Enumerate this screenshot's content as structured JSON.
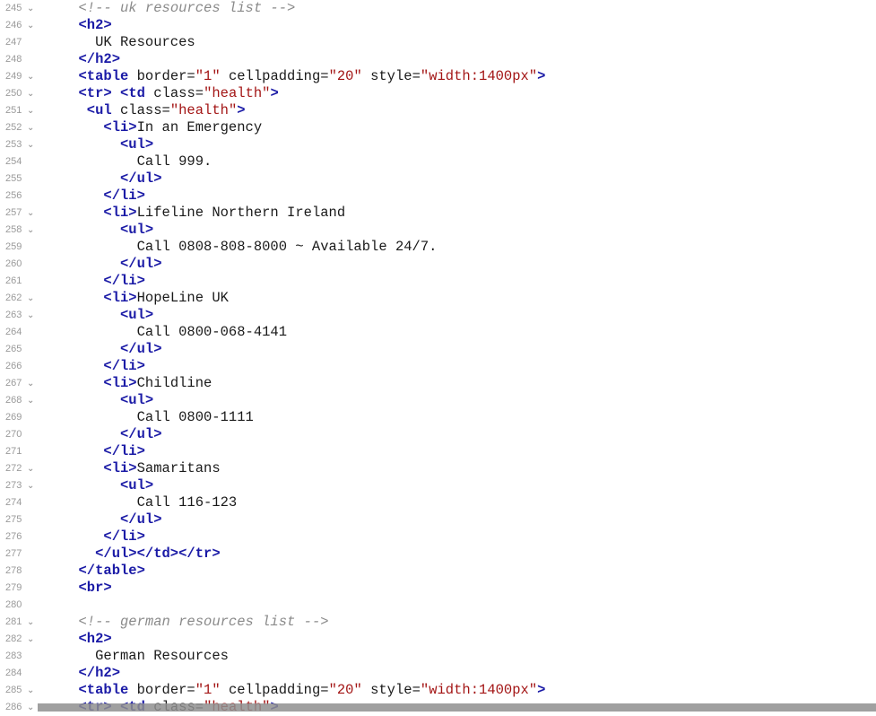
{
  "lines": [
    {
      "n": "245",
      "fold": true,
      "indent": 0,
      "tokens": [
        {
          "t": "cmt",
          "v": "<!-- uk resources list -->"
        }
      ]
    },
    {
      "n": "246",
      "fold": true,
      "indent": 0,
      "tokens": [
        {
          "t": "tag",
          "v": "<h2>"
        }
      ]
    },
    {
      "n": "247",
      "fold": false,
      "indent": 2,
      "tokens": [
        {
          "t": "txt",
          "v": "UK Resources"
        }
      ]
    },
    {
      "n": "248",
      "fold": false,
      "indent": 0,
      "tokens": [
        {
          "t": "tag",
          "v": "</h2>"
        }
      ]
    },
    {
      "n": "249",
      "fold": true,
      "indent": 0,
      "tokens": [
        {
          "t": "tag",
          "v": "<table"
        },
        {
          "t": "attr",
          "v": " border="
        },
        {
          "t": "str",
          "v": "\"1\""
        },
        {
          "t": "attr",
          "v": " cellpadding="
        },
        {
          "t": "str",
          "v": "\"20\""
        },
        {
          "t": "attr",
          "v": " style="
        },
        {
          "t": "str",
          "v": "\"width:1400px\""
        },
        {
          "t": "tag",
          "v": ">"
        }
      ]
    },
    {
      "n": "250",
      "fold": true,
      "indent": 0,
      "tokens": [
        {
          "t": "tag",
          "v": "<tr>"
        },
        {
          "t": "txt",
          "v": " "
        },
        {
          "t": "tag",
          "v": "<td"
        },
        {
          "t": "attr",
          "v": " class="
        },
        {
          "t": "str",
          "v": "\"health\""
        },
        {
          "t": "tag",
          "v": ">"
        }
      ]
    },
    {
      "n": "251",
      "fold": true,
      "indent": 1,
      "tokens": [
        {
          "t": "tag",
          "v": "<ul"
        },
        {
          "t": "attr",
          "v": " class="
        },
        {
          "t": "str",
          "v": "\"health\""
        },
        {
          "t": "tag",
          "v": ">"
        }
      ]
    },
    {
      "n": "252",
      "fold": true,
      "indent": 3,
      "tokens": [
        {
          "t": "tag",
          "v": "<li>"
        },
        {
          "t": "txt",
          "v": "In an Emergency"
        }
      ]
    },
    {
      "n": "253",
      "fold": true,
      "indent": 5,
      "tokens": [
        {
          "t": "tag",
          "v": "<ul>"
        }
      ]
    },
    {
      "n": "254",
      "fold": false,
      "indent": 7,
      "tokens": [
        {
          "t": "txt",
          "v": "Call 999."
        }
      ]
    },
    {
      "n": "255",
      "fold": false,
      "indent": 5,
      "tokens": [
        {
          "t": "tag",
          "v": "</ul>"
        }
      ]
    },
    {
      "n": "256",
      "fold": false,
      "indent": 3,
      "tokens": [
        {
          "t": "tag",
          "v": "</li>"
        }
      ]
    },
    {
      "n": "257",
      "fold": true,
      "indent": 3,
      "tokens": [
        {
          "t": "tag",
          "v": "<li>"
        },
        {
          "t": "txt",
          "v": "Lifeline Northern Ireland"
        }
      ]
    },
    {
      "n": "258",
      "fold": true,
      "indent": 5,
      "tokens": [
        {
          "t": "tag",
          "v": "<ul>"
        }
      ]
    },
    {
      "n": "259",
      "fold": false,
      "indent": 7,
      "tokens": [
        {
          "t": "txt",
          "v": "Call 0808-808-8000 ~ Available 24/7."
        }
      ]
    },
    {
      "n": "260",
      "fold": false,
      "indent": 5,
      "tokens": [
        {
          "t": "tag",
          "v": "</ul>"
        }
      ]
    },
    {
      "n": "261",
      "fold": false,
      "indent": 3,
      "tokens": [
        {
          "t": "tag",
          "v": "</li>"
        }
      ]
    },
    {
      "n": "262",
      "fold": true,
      "indent": 3,
      "tokens": [
        {
          "t": "tag",
          "v": "<li>"
        },
        {
          "t": "txt",
          "v": "HopeLine UK"
        }
      ]
    },
    {
      "n": "263",
      "fold": true,
      "indent": 5,
      "tokens": [
        {
          "t": "tag",
          "v": "<ul>"
        }
      ]
    },
    {
      "n": "264",
      "fold": false,
      "indent": 7,
      "tokens": [
        {
          "t": "txt",
          "v": "Call 0800-068-4141"
        }
      ]
    },
    {
      "n": "265",
      "fold": false,
      "indent": 5,
      "tokens": [
        {
          "t": "tag",
          "v": "</ul>"
        }
      ]
    },
    {
      "n": "266",
      "fold": false,
      "indent": 3,
      "tokens": [
        {
          "t": "tag",
          "v": "</li>"
        }
      ]
    },
    {
      "n": "267",
      "fold": true,
      "indent": 3,
      "tokens": [
        {
          "t": "tag",
          "v": "<li>"
        },
        {
          "t": "txt",
          "v": "Childline"
        }
      ]
    },
    {
      "n": "268",
      "fold": true,
      "indent": 5,
      "tokens": [
        {
          "t": "tag",
          "v": "<ul>"
        }
      ]
    },
    {
      "n": "269",
      "fold": false,
      "indent": 7,
      "tokens": [
        {
          "t": "txt",
          "v": "Call 0800-1111"
        }
      ]
    },
    {
      "n": "270",
      "fold": false,
      "indent": 5,
      "tokens": [
        {
          "t": "tag",
          "v": "</ul>"
        }
      ]
    },
    {
      "n": "271",
      "fold": false,
      "indent": 3,
      "tokens": [
        {
          "t": "tag",
          "v": "</li>"
        }
      ]
    },
    {
      "n": "272",
      "fold": true,
      "indent": 3,
      "tokens": [
        {
          "t": "tag",
          "v": "<li>"
        },
        {
          "t": "txt",
          "v": "Samaritans"
        }
      ]
    },
    {
      "n": "273",
      "fold": true,
      "indent": 5,
      "tokens": [
        {
          "t": "tag",
          "v": "<ul>"
        }
      ]
    },
    {
      "n": "274",
      "fold": false,
      "indent": 7,
      "tokens": [
        {
          "t": "txt",
          "v": "Call 116-123"
        }
      ]
    },
    {
      "n": "275",
      "fold": false,
      "indent": 5,
      "tokens": [
        {
          "t": "tag",
          "v": "</ul>"
        }
      ]
    },
    {
      "n": "276",
      "fold": false,
      "indent": 3,
      "tokens": [
        {
          "t": "tag",
          "v": "</li>"
        }
      ]
    },
    {
      "n": "277",
      "fold": false,
      "indent": 2,
      "tokens": [
        {
          "t": "tag",
          "v": "</ul></td></tr>"
        }
      ]
    },
    {
      "n": "278",
      "fold": false,
      "indent": 0,
      "tokens": [
        {
          "t": "tag",
          "v": "</table>"
        }
      ]
    },
    {
      "n": "279",
      "fold": false,
      "indent": 0,
      "tokens": [
        {
          "t": "tag",
          "v": "<br>"
        }
      ]
    },
    {
      "n": "280",
      "fold": false,
      "indent": 0,
      "tokens": []
    },
    {
      "n": "281",
      "fold": true,
      "indent": 0,
      "tokens": [
        {
          "t": "cmt",
          "v": "<!-- german resources list -->"
        }
      ]
    },
    {
      "n": "282",
      "fold": true,
      "indent": 0,
      "tokens": [
        {
          "t": "tag",
          "v": "<h2>"
        }
      ]
    },
    {
      "n": "283",
      "fold": false,
      "indent": 2,
      "tokens": [
        {
          "t": "txt",
          "v": "German Resources"
        }
      ]
    },
    {
      "n": "284",
      "fold": false,
      "indent": 0,
      "tokens": [
        {
          "t": "tag",
          "v": "</h2>"
        }
      ]
    },
    {
      "n": "285",
      "fold": true,
      "indent": 0,
      "tokens": [
        {
          "t": "tag",
          "v": "<table"
        },
        {
          "t": "attr",
          "v": " border="
        },
        {
          "t": "str",
          "v": "\"1\""
        },
        {
          "t": "attr",
          "v": " cellpadding="
        },
        {
          "t": "str",
          "v": "\"20\""
        },
        {
          "t": "attr",
          "v": " style="
        },
        {
          "t": "str",
          "v": "\"width:1400px\""
        },
        {
          "t": "tag",
          "v": ">"
        }
      ]
    },
    {
      "n": "286",
      "fold": true,
      "indent": 0,
      "tokens": [
        {
          "t": "tag",
          "v": "<tr>"
        },
        {
          "t": "txt",
          "v": " "
        },
        {
          "t": "tag",
          "v": "<td"
        },
        {
          "t": "attr",
          "v": " class="
        },
        {
          "t": "str",
          "v": "\"health\""
        },
        {
          "t": "tag",
          "v": ">"
        }
      ]
    }
  ],
  "fold_icon": "chevron-down-icon",
  "colors": {
    "tag": "#1a1aa6",
    "string": "#a31515",
    "comment": "#8a8a8a",
    "text": "#1a1a1a",
    "line_number": "#9a9a9a"
  }
}
